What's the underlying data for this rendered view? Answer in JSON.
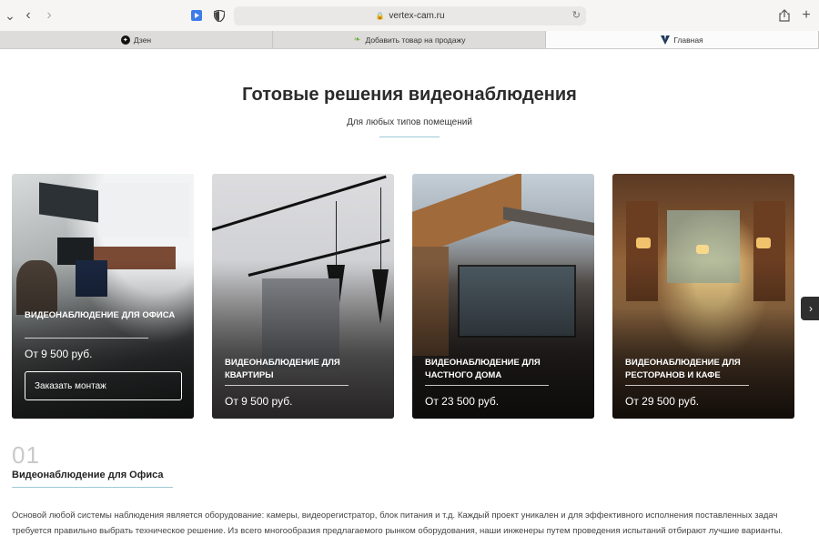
{
  "browser": {
    "url": "vertex-cam.ru",
    "tabs": [
      {
        "label": "Дзен",
        "icon": "dzen-icon"
      },
      {
        "label": "Добавить товар на продажу",
        "icon": "leaf-icon"
      },
      {
        "label": "Главная",
        "icon": "v-logo-icon"
      }
    ]
  },
  "header": {
    "title": "Готовые решения видеонаблюдения",
    "subtitle": "Для любых типов помещений"
  },
  "cards": [
    {
      "title": "Видеонаблюдение для офиса",
      "price": "От 9 500 руб.",
      "button": "Заказать монтаж"
    },
    {
      "title": "Видеонаблюдение для квартиры",
      "price": "От 9 500 руб."
    },
    {
      "title": "Видеонаблюдение для частного дома",
      "price": "От 23 500 руб."
    },
    {
      "title": "Видеонаблюдение для ресторанов и кафе",
      "price": "От 29 500 руб."
    }
  ],
  "section": {
    "number": "01",
    "title": "Видеонаблюдение для Офиса",
    "text": "Основой любой системы наблюдения является оборудование: камеры, видеорегистратор, блок питания и т.д. Каждый проект уникален и для эффективного исполнения поставленных задач требуется правильно выбрать техническое решение. Из всего многообразия предлагаемого рынком оборудования, наши инженеры путем проведения испытаний отбирают лучшие варианты."
  },
  "colors": {
    "accent_line": "#9ec9d6",
    "arrow_bg": "#2f2f2f"
  }
}
